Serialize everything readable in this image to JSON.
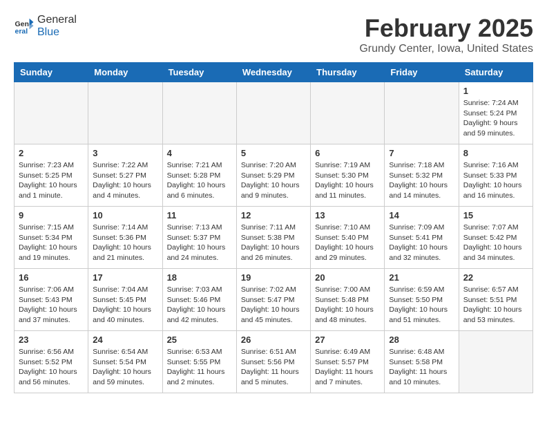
{
  "header": {
    "logo_line1": "General",
    "logo_line2": "Blue",
    "title": "February 2025",
    "subtitle": "Grundy Center, Iowa, United States"
  },
  "weekdays": [
    "Sunday",
    "Monday",
    "Tuesday",
    "Wednesday",
    "Thursday",
    "Friday",
    "Saturday"
  ],
  "weeks": [
    [
      {
        "day": "",
        "info": ""
      },
      {
        "day": "",
        "info": ""
      },
      {
        "day": "",
        "info": ""
      },
      {
        "day": "",
        "info": ""
      },
      {
        "day": "",
        "info": ""
      },
      {
        "day": "",
        "info": ""
      },
      {
        "day": "1",
        "info": "Sunrise: 7:24 AM\nSunset: 5:24 PM\nDaylight: 9 hours\nand 59 minutes."
      }
    ],
    [
      {
        "day": "2",
        "info": "Sunrise: 7:23 AM\nSunset: 5:25 PM\nDaylight: 10 hours\nand 1 minute."
      },
      {
        "day": "3",
        "info": "Sunrise: 7:22 AM\nSunset: 5:27 PM\nDaylight: 10 hours\nand 4 minutes."
      },
      {
        "day": "4",
        "info": "Sunrise: 7:21 AM\nSunset: 5:28 PM\nDaylight: 10 hours\nand 6 minutes."
      },
      {
        "day": "5",
        "info": "Sunrise: 7:20 AM\nSunset: 5:29 PM\nDaylight: 10 hours\nand 9 minutes."
      },
      {
        "day": "6",
        "info": "Sunrise: 7:19 AM\nSunset: 5:30 PM\nDaylight: 10 hours\nand 11 minutes."
      },
      {
        "day": "7",
        "info": "Sunrise: 7:18 AM\nSunset: 5:32 PM\nDaylight: 10 hours\nand 14 minutes."
      },
      {
        "day": "8",
        "info": "Sunrise: 7:16 AM\nSunset: 5:33 PM\nDaylight: 10 hours\nand 16 minutes."
      }
    ],
    [
      {
        "day": "9",
        "info": "Sunrise: 7:15 AM\nSunset: 5:34 PM\nDaylight: 10 hours\nand 19 minutes."
      },
      {
        "day": "10",
        "info": "Sunrise: 7:14 AM\nSunset: 5:36 PM\nDaylight: 10 hours\nand 21 minutes."
      },
      {
        "day": "11",
        "info": "Sunrise: 7:13 AM\nSunset: 5:37 PM\nDaylight: 10 hours\nand 24 minutes."
      },
      {
        "day": "12",
        "info": "Sunrise: 7:11 AM\nSunset: 5:38 PM\nDaylight: 10 hours\nand 26 minutes."
      },
      {
        "day": "13",
        "info": "Sunrise: 7:10 AM\nSunset: 5:40 PM\nDaylight: 10 hours\nand 29 minutes."
      },
      {
        "day": "14",
        "info": "Sunrise: 7:09 AM\nSunset: 5:41 PM\nDaylight: 10 hours\nand 32 minutes."
      },
      {
        "day": "15",
        "info": "Sunrise: 7:07 AM\nSunset: 5:42 PM\nDaylight: 10 hours\nand 34 minutes."
      }
    ],
    [
      {
        "day": "16",
        "info": "Sunrise: 7:06 AM\nSunset: 5:43 PM\nDaylight: 10 hours\nand 37 minutes."
      },
      {
        "day": "17",
        "info": "Sunrise: 7:04 AM\nSunset: 5:45 PM\nDaylight: 10 hours\nand 40 minutes."
      },
      {
        "day": "18",
        "info": "Sunrise: 7:03 AM\nSunset: 5:46 PM\nDaylight: 10 hours\nand 42 minutes."
      },
      {
        "day": "19",
        "info": "Sunrise: 7:02 AM\nSunset: 5:47 PM\nDaylight: 10 hours\nand 45 minutes."
      },
      {
        "day": "20",
        "info": "Sunrise: 7:00 AM\nSunset: 5:48 PM\nDaylight: 10 hours\nand 48 minutes."
      },
      {
        "day": "21",
        "info": "Sunrise: 6:59 AM\nSunset: 5:50 PM\nDaylight: 10 hours\nand 51 minutes."
      },
      {
        "day": "22",
        "info": "Sunrise: 6:57 AM\nSunset: 5:51 PM\nDaylight: 10 hours\nand 53 minutes."
      }
    ],
    [
      {
        "day": "23",
        "info": "Sunrise: 6:56 AM\nSunset: 5:52 PM\nDaylight: 10 hours\nand 56 minutes."
      },
      {
        "day": "24",
        "info": "Sunrise: 6:54 AM\nSunset: 5:54 PM\nDaylight: 10 hours\nand 59 minutes."
      },
      {
        "day": "25",
        "info": "Sunrise: 6:53 AM\nSunset: 5:55 PM\nDaylight: 11 hours\nand 2 minutes."
      },
      {
        "day": "26",
        "info": "Sunrise: 6:51 AM\nSunset: 5:56 PM\nDaylight: 11 hours\nand 5 minutes."
      },
      {
        "day": "27",
        "info": "Sunrise: 6:49 AM\nSunset: 5:57 PM\nDaylight: 11 hours\nand 7 minutes."
      },
      {
        "day": "28",
        "info": "Sunrise: 6:48 AM\nSunset: 5:58 PM\nDaylight: 11 hours\nand 10 minutes."
      },
      {
        "day": "",
        "info": ""
      }
    ]
  ]
}
